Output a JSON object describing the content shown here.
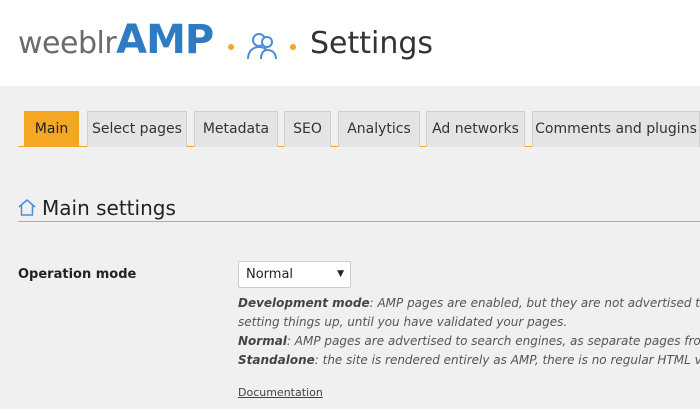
{
  "header": {
    "logo_part1": "weeblr",
    "logo_part2": "AMP",
    "icon": "users-icon",
    "title": "Settings",
    "dot_color": "#f5a623",
    "logo_color": "#2e7bc4"
  },
  "tabs": [
    {
      "label": "Main",
      "active": true
    },
    {
      "label": "Select pages",
      "active": false
    },
    {
      "label": "Metadata",
      "active": false
    },
    {
      "label": "SEO",
      "active": false
    },
    {
      "label": "Analytics",
      "active": false
    },
    {
      "label": "Ad networks",
      "active": false
    },
    {
      "label": "Comments and plugins",
      "active": false
    }
  ],
  "section": {
    "icon": "home-icon",
    "title": "Main settings"
  },
  "operation_mode": {
    "label": "Operation mode",
    "selected": "Normal",
    "help": [
      {
        "term": "Development mode",
        "text": ": AMP pages are enabled, but they are not advertised to search engines. Use this mode while"
      },
      {
        "term": "",
        "text": "setting things up, until you have validated your pages."
      },
      {
        "term": "Normal",
        "text": ": AMP pages are advertised to search engines, as separate pages from the regular HTML pages."
      },
      {
        "term": "Standalone",
        "text": ": the site is rendered entirely as AMP, there is no regular HTML version of the pages."
      }
    ],
    "doc_link": "Documentation"
  }
}
